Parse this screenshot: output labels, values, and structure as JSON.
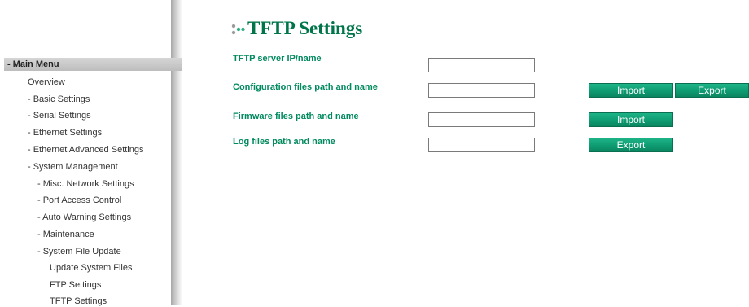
{
  "sidebar": {
    "header": "- Main Menu",
    "items": [
      "Overview",
      "- Basic Settings",
      "- Serial Settings",
      "- Ethernet Settings",
      "- Ethernet Advanced Settings",
      "- System Management",
      "- Misc. Network Settings",
      "- Port Access Control",
      "- Auto Warning Settings",
      "- Maintenance",
      "- System File Update",
      "Update System Files",
      "FTP Settings",
      "TFTP Settings"
    ]
  },
  "page": {
    "title": "TFTP Settings",
    "title_icon": "dots-icon",
    "accent_color": "#008a5e"
  },
  "settings": [
    {
      "label": "TFTP server IP/name",
      "value": ""
    },
    {
      "label": "Configuration files path and name",
      "value": ""
    },
    {
      "label": "Firmware files path and name",
      "value": ""
    },
    {
      "label": "Log files path and name",
      "value": ""
    }
  ],
  "buttons": {
    "import": "Import",
    "export": "Export"
  }
}
